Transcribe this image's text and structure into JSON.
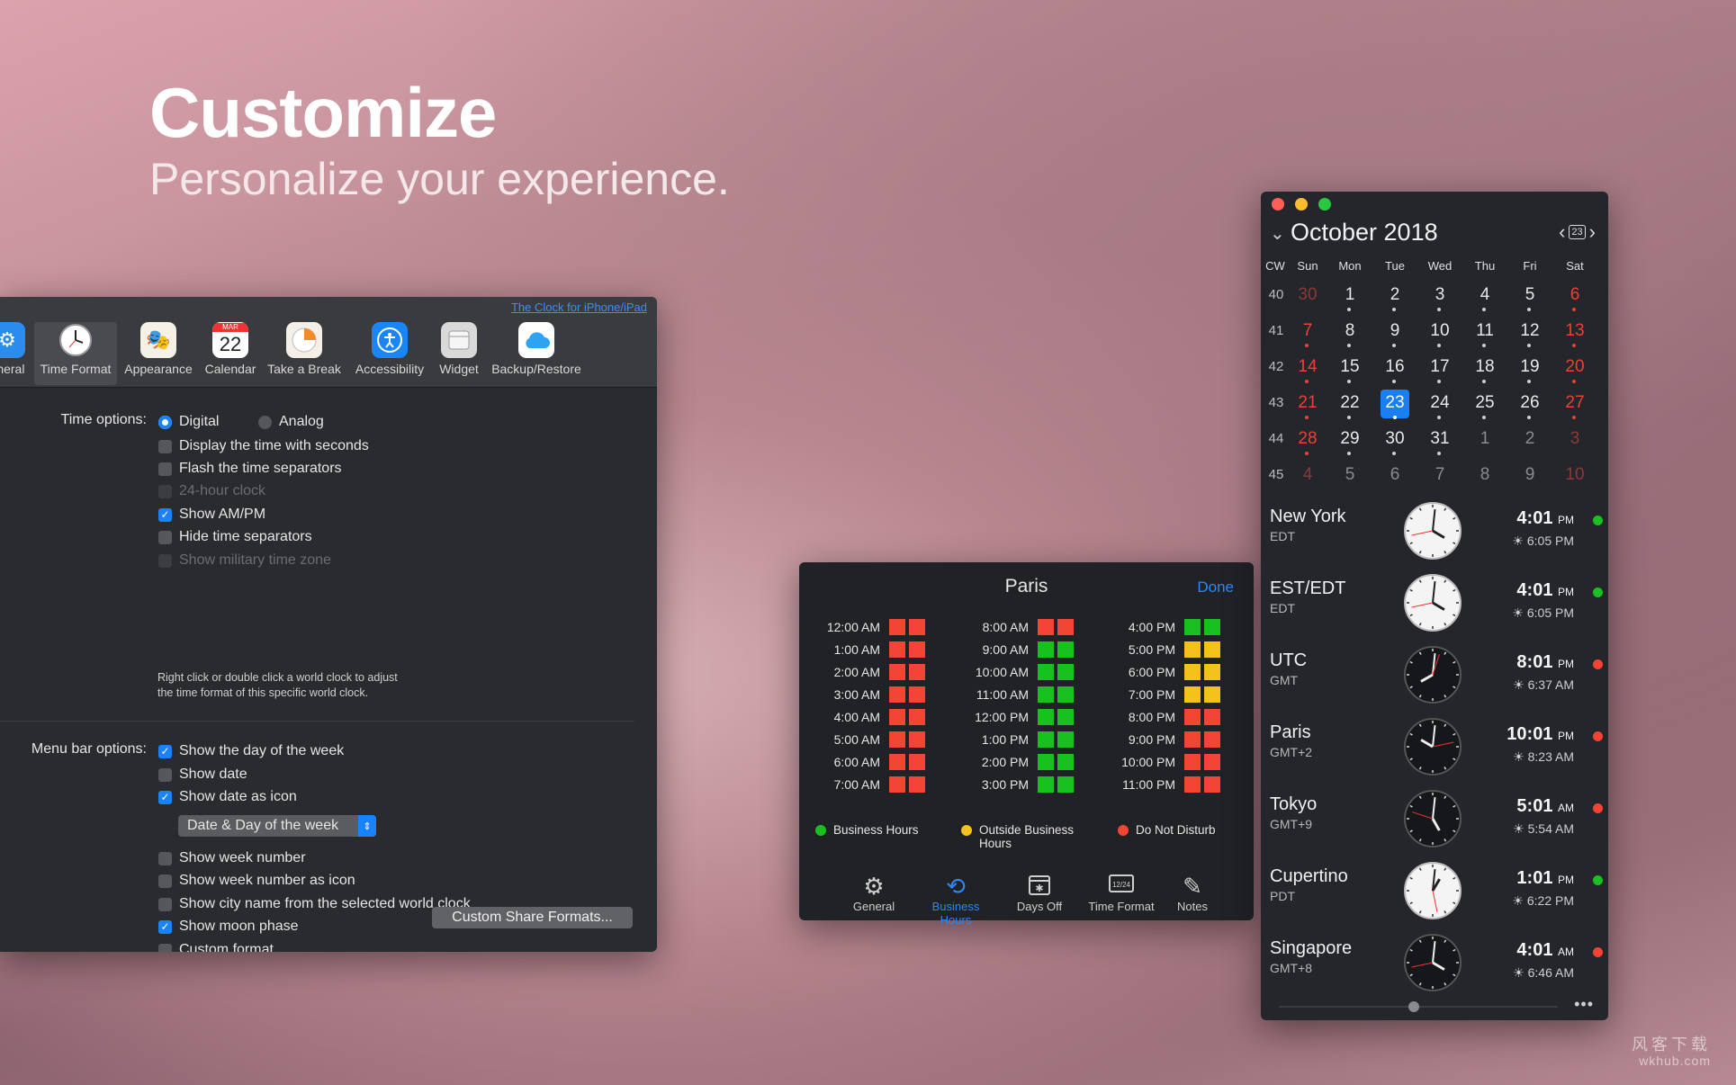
{
  "hero": {
    "title": "Customize",
    "subtitle": "Personalize your experience."
  },
  "prefs": {
    "link": "The Clock for iPhone/iPad",
    "toolbar": [
      {
        "label": "eneral",
        "icon": "gear-icon"
      },
      {
        "label": "Time Format",
        "icon": "clock-icon"
      },
      {
        "label": "Appearance",
        "icon": "theater-masks-icon"
      },
      {
        "label": "Calendar",
        "icon": "calendar-icon",
        "month": "MAR",
        "day": "22"
      },
      {
        "label": "Take a Break",
        "icon": "pie-timer-icon"
      },
      {
        "label": "Accessibility",
        "icon": "accessibility-icon"
      },
      {
        "label": "Widget",
        "icon": "widget-icon"
      },
      {
        "label": "Backup/Restore",
        "icon": "cloud-icon"
      }
    ],
    "time_options_label": "Time options:",
    "radio_digital": "Digital",
    "radio_analog": "Analog",
    "time_checks": [
      {
        "label": "Display the time with seconds",
        "checked": false,
        "enabled": true
      },
      {
        "label": "Flash the time separators",
        "checked": false,
        "enabled": true
      },
      {
        "label": "24-hour clock",
        "checked": false,
        "enabled": false
      },
      {
        "label": "Show AM/PM",
        "checked": true,
        "enabled": true
      },
      {
        "label": "Hide time separators",
        "checked": false,
        "enabled": true
      },
      {
        "label": "Show military time zone",
        "checked": false,
        "enabled": false
      }
    ],
    "note_line1": "Right click or double click a world clock to adjust",
    "note_line2": "the time format of this specific world clock.",
    "menu_bar_label": "Menu bar options:",
    "menu_checks_a": [
      {
        "label": "Show the day of the week",
        "checked": true
      },
      {
        "label": "Show date",
        "checked": false
      },
      {
        "label": "Show date as icon",
        "checked": true
      }
    ],
    "date_style_select": "Date & Day of the week",
    "menu_checks_b": [
      {
        "label": "Show week number",
        "checked": false
      },
      {
        "label": "Show week number as icon",
        "checked": false
      },
      {
        "label": "Show city name from the selected world clock",
        "checked": false
      },
      {
        "label": "Show moon phase",
        "checked": true
      },
      {
        "label": "Custom format",
        "checked": false
      }
    ],
    "share_button": "Custom Share Formats..."
  },
  "business_hours": {
    "title": "Paris",
    "done": "Done",
    "colors": {
      "business": "#19c11f",
      "outside": "#f5c11b",
      "dnd": "#f24533"
    },
    "columns": [
      [
        {
          "time": "12:00 AM",
          "status": "dnd"
        },
        {
          "time": "1:00 AM",
          "status": "dnd"
        },
        {
          "time": "2:00 AM",
          "status": "dnd"
        },
        {
          "time": "3:00 AM",
          "status": "dnd"
        },
        {
          "time": "4:00 AM",
          "status": "dnd"
        },
        {
          "time": "5:00 AM",
          "status": "dnd"
        },
        {
          "time": "6:00 AM",
          "status": "dnd"
        },
        {
          "time": "7:00 AM",
          "status": "dnd"
        }
      ],
      [
        {
          "time": "8:00 AM",
          "status": "dnd"
        },
        {
          "time": "9:00 AM",
          "status": "business"
        },
        {
          "time": "10:00 AM",
          "status": "business"
        },
        {
          "time": "11:00 AM",
          "status": "business"
        },
        {
          "time": "12:00 PM",
          "status": "business"
        },
        {
          "time": "1:00 PM",
          "status": "business"
        },
        {
          "time": "2:00 PM",
          "status": "business"
        },
        {
          "time": "3:00 PM",
          "status": "business"
        }
      ],
      [
        {
          "time": "4:00 PM",
          "status": "business"
        },
        {
          "time": "5:00 PM",
          "status": "outside"
        },
        {
          "time": "6:00 PM",
          "status": "outside"
        },
        {
          "time": "7:00 PM",
          "status": "outside"
        },
        {
          "time": "8:00 PM",
          "status": "dnd"
        },
        {
          "time": "9:00 PM",
          "status": "dnd"
        },
        {
          "time": "10:00 PM",
          "status": "dnd"
        },
        {
          "time": "11:00 PM",
          "status": "dnd"
        }
      ]
    ],
    "legend": {
      "business": "Business Hours",
      "outside_1": "Outside Business",
      "outside_2": "Hours",
      "dnd": "Do Not Disturb"
    },
    "tabs": [
      {
        "label": "General",
        "icon": "gear-icon"
      },
      {
        "label": "Business Hours",
        "icon": "clock-arrow-icon"
      },
      {
        "label": "Days Off",
        "icon": "calendar-snowflake-icon"
      },
      {
        "label": "Time Format",
        "icon": "time-format-icon"
      },
      {
        "label": "Notes",
        "icon": "pencil-icon"
      }
    ]
  },
  "calendar": {
    "month": "October 2018",
    "cw_label": "CW",
    "weekdays": [
      "Sun",
      "Mon",
      "Tue",
      "Wed",
      "Thu",
      "Fri",
      "Sat"
    ],
    "weeks": [
      {
        "cw": "40",
        "days": [
          [
            "30",
            "o"
          ],
          [
            "1",
            "d"
          ],
          [
            "2",
            "d"
          ],
          [
            "3",
            "d"
          ],
          [
            "4",
            "d"
          ],
          [
            "5",
            "d"
          ],
          [
            "6",
            "d"
          ]
        ]
      },
      {
        "cw": "41",
        "days": [
          [
            "7",
            "d"
          ],
          [
            "8",
            "d"
          ],
          [
            "9",
            "d"
          ],
          [
            "10",
            "d"
          ],
          [
            "11",
            "d"
          ],
          [
            "12",
            "d"
          ],
          [
            "13",
            "d"
          ]
        ]
      },
      {
        "cw": "42",
        "days": [
          [
            "14",
            "d"
          ],
          [
            "15",
            "d"
          ],
          [
            "16",
            "d"
          ],
          [
            "17",
            "d"
          ],
          [
            "18",
            "d"
          ],
          [
            "19",
            "d"
          ],
          [
            "20",
            "d"
          ]
        ]
      },
      {
        "cw": "43",
        "days": [
          [
            "21",
            "d"
          ],
          [
            "22",
            "d"
          ],
          [
            "23",
            "t"
          ],
          [
            "24",
            "d"
          ],
          [
            "25",
            "d"
          ],
          [
            "26",
            "d"
          ],
          [
            "27",
            "d"
          ]
        ]
      },
      {
        "cw": "44",
        "days": [
          [
            "28",
            "d"
          ],
          [
            "29",
            "d"
          ],
          [
            "30",
            "d"
          ],
          [
            "31",
            "d"
          ],
          [
            "1",
            "o"
          ],
          [
            "2",
            "o"
          ],
          [
            "3",
            "o"
          ]
        ]
      },
      {
        "cw": "45",
        "days": [
          [
            "4",
            "o"
          ],
          [
            "5",
            "o"
          ],
          [
            "6",
            "o"
          ],
          [
            "7",
            "o"
          ],
          [
            "8",
            "o"
          ],
          [
            "9",
            "o"
          ],
          [
            "10",
            "o"
          ]
        ]
      }
    ],
    "today_badge": "23",
    "clocks": [
      {
        "city": "New York",
        "tz": "EDT",
        "time": "4:01",
        "ampm": "PM",
        "sun": "6:05 PM",
        "status": "#19c11f",
        "face": "light",
        "h": 4,
        "m": 1
      },
      {
        "city": "EST/EDT",
        "tz": "EDT",
        "time": "4:01",
        "ampm": "PM",
        "sun": "6:05 PM",
        "status": "#19c11f",
        "face": "light",
        "h": 4,
        "m": 1
      },
      {
        "city": "UTC",
        "tz": "GMT",
        "time": "8:01",
        "ampm": "PM",
        "sun": "6:37 AM",
        "status": "#f24533",
        "face": "dark",
        "h": 8,
        "m": 1
      },
      {
        "city": "Paris",
        "tz": "GMT+2",
        "time": "10:01",
        "ampm": "PM",
        "sun": "8:23 AM",
        "status": "#f24533",
        "face": "dark",
        "h": 10,
        "m": 1
      },
      {
        "city": "Tokyo",
        "tz": "GMT+9",
        "time": "5:01",
        "ampm": "AM",
        "sun": "5:54 AM",
        "status": "#f24533",
        "face": "dark",
        "h": 5,
        "m": 1
      },
      {
        "city": "Cupertino",
        "tz": "PDT",
        "time": "1:01",
        "ampm": "PM",
        "sun": "6:22 PM",
        "status": "#19c11f",
        "face": "light",
        "h": 1,
        "m": 1
      },
      {
        "city": "Singapore",
        "tz": "GMT+8",
        "time": "4:01",
        "ampm": "AM",
        "sun": "6:46 AM",
        "status": "#f24533",
        "face": "dark",
        "h": 4,
        "m": 1
      }
    ],
    "more": "•••"
  },
  "watermark": {
    "line1": "风客下载",
    "line2": "wkhub.com"
  }
}
